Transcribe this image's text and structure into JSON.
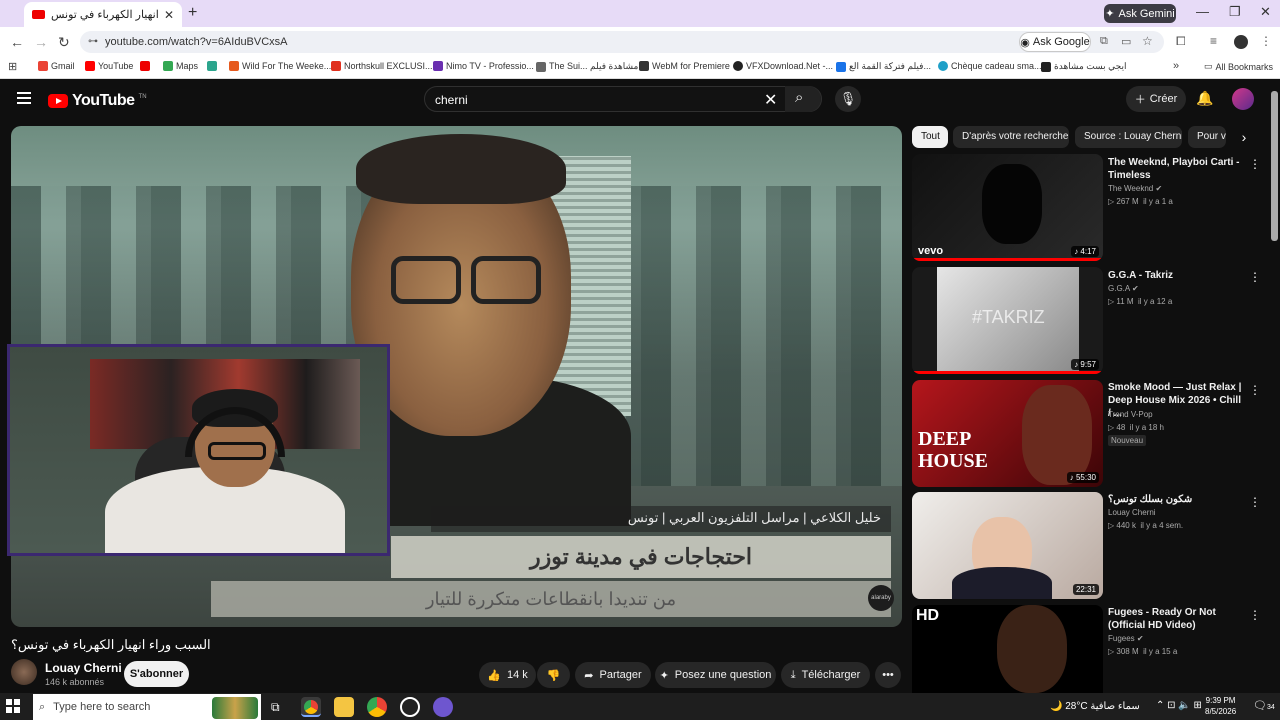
{
  "browser": {
    "tab_title": "السبب وراء انهيار الكهرباء في تونس",
    "new_tab": "+",
    "ask_gemini": "Ask Gemini",
    "url": "youtube.com/watch?v=6AIduBVCxsA",
    "ask_google": "Ask Google",
    "all_bookmarks": "All Bookmarks",
    "bookmarks": [
      "Gmail",
      "YouTube",
      "",
      "Maps",
      "",
      "Wild For The Weeke...",
      "Northskull EXCLUSI...",
      "Nimo TV - Professio...",
      "The Sui... مشاهدة فيلم",
      "WebM for Premiere",
      "VFXDownload.Net -...",
      "فيلم فتركة القمة الع...",
      "Chèque cadeau sma...",
      "ايجي بست مشاهدة"
    ],
    "bookmark_colors": [
      "#ea4335",
      "#ff0000",
      "#e00",
      "#34a853",
      "#2ca58d",
      "#e65a1e",
      "#e0301e",
      "#6a2fb0",
      "#666",
      "#333",
      "#222",
      "#1a73e8",
      "#1fa0c8",
      "#222"
    ]
  },
  "youtube": {
    "logo": "YouTube",
    "logo_suffix": "TN",
    "search_value": "cherni",
    "create_label": "Créer"
  },
  "video": {
    "lower_third": "خليل الكلاعي | مراسل التلفزيون العربي | تونس",
    "banner_line1": "احتجاجات في مدينة توزر",
    "banner_line2": "من تنديدا بانقطاعات متكررة للتيار",
    "watermark": "alaraby",
    "title": "السبب وراء انهيار الكهرباء في تونس؟",
    "channel": "Louay Cherni",
    "subscribers": "146 k abonnés",
    "subscribe_label": "S'abonner",
    "likes": "14 k",
    "share_label": "Partager",
    "ask_label": "Posez une question",
    "download_label": "Télécharger"
  },
  "chips": [
    "Tout",
    "D'après votre recherche",
    "Source : Louay Cherni",
    "Pour vous"
  ],
  "recommendations": [
    {
      "title": "The Weeknd, Playboi Carti - Timeless",
      "channel": "The Weeknd",
      "verified": true,
      "views": "267 M",
      "age": "il y a 1 a",
      "duration": "4:17",
      "brand": "vevo",
      "badge": "",
      "colors": [
        "#111",
        "#2a2a2a"
      ]
    },
    {
      "title": "G.G.A - Takriz",
      "channel": "G.G.A",
      "verified": true,
      "views": "11 M",
      "age": "il y a 12 a",
      "duration": "9:57",
      "brand": "",
      "badge": "",
      "colors": [
        "#cfcfcf",
        "#8a8a8a"
      ]
    },
    {
      "title": "Smoke Mood — Just Relax | Deep House Mix 2026 • Chill / ...",
      "channel": "Trend V-Pop",
      "verified": false,
      "views": "48",
      "age": "il y a 18 h",
      "duration": "55:30",
      "brand": "DEEP HOUSE",
      "badge": "Nouveau",
      "colors": [
        "#b5161c",
        "#3b0507"
      ]
    },
    {
      "title": "شكون بسلك تونس؟",
      "channel": "Louay Cherni",
      "verified": false,
      "views": "440 k",
      "age": "il y a 4 sem.",
      "duration": "22:31",
      "brand": "",
      "badge": "",
      "colors": [
        "#f0eeeb",
        "#b9a9a0"
      ]
    },
    {
      "title": "Fugees - Ready Or Not (Official HD Video)",
      "channel": "Fugees",
      "verified": true,
      "views": "308 M",
      "age": "il y a 15 a",
      "duration": "",
      "brand": "HD",
      "badge": "",
      "colors": [
        "#000",
        "#2a1a14"
      ]
    }
  ],
  "taskbar": {
    "search_placeholder": "Type here to search",
    "weather": "28°C  سماء صافية",
    "time": "9:39 PM",
    "date": "8/5/2026",
    "notifications": "34"
  }
}
